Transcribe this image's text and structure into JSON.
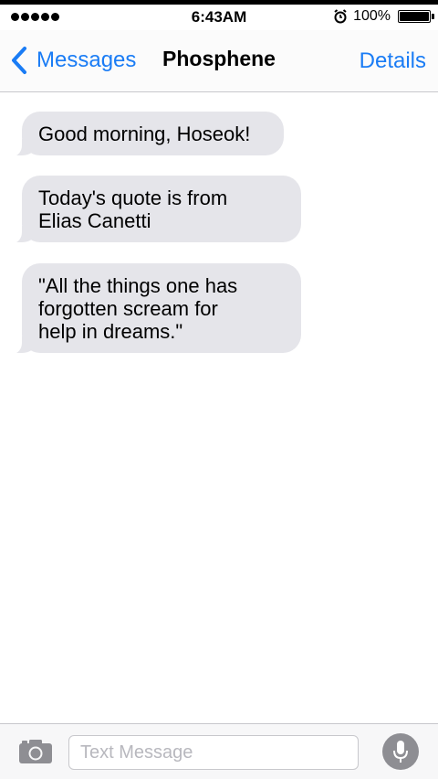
{
  "status_bar": {
    "time": "6:43AM",
    "battery_percent": "100%",
    "signal_bars": 5,
    "alarm_icon": "alarm-clock-icon",
    "battery_level": 1.0
  },
  "nav": {
    "back_label": "Messages",
    "title": "Phosphene",
    "details_label": "Details",
    "accent": "#1a7cf5"
  },
  "messages": [
    {
      "text": "Good morning, Hoseok!"
    },
    {
      "text": "Today's quote is from\nElias Canetti"
    },
    {
      "text": "\"All the things one has\nforgotten scream for\nhelp in dreams.\""
    }
  ],
  "composer": {
    "placeholder": "Text Message",
    "camera_icon": "camera-icon",
    "mic_icon": "microphone-icon"
  },
  "colors": {
    "bubble_bg": "#e5e5ea",
    "icon_gray": "#8e8e93"
  }
}
